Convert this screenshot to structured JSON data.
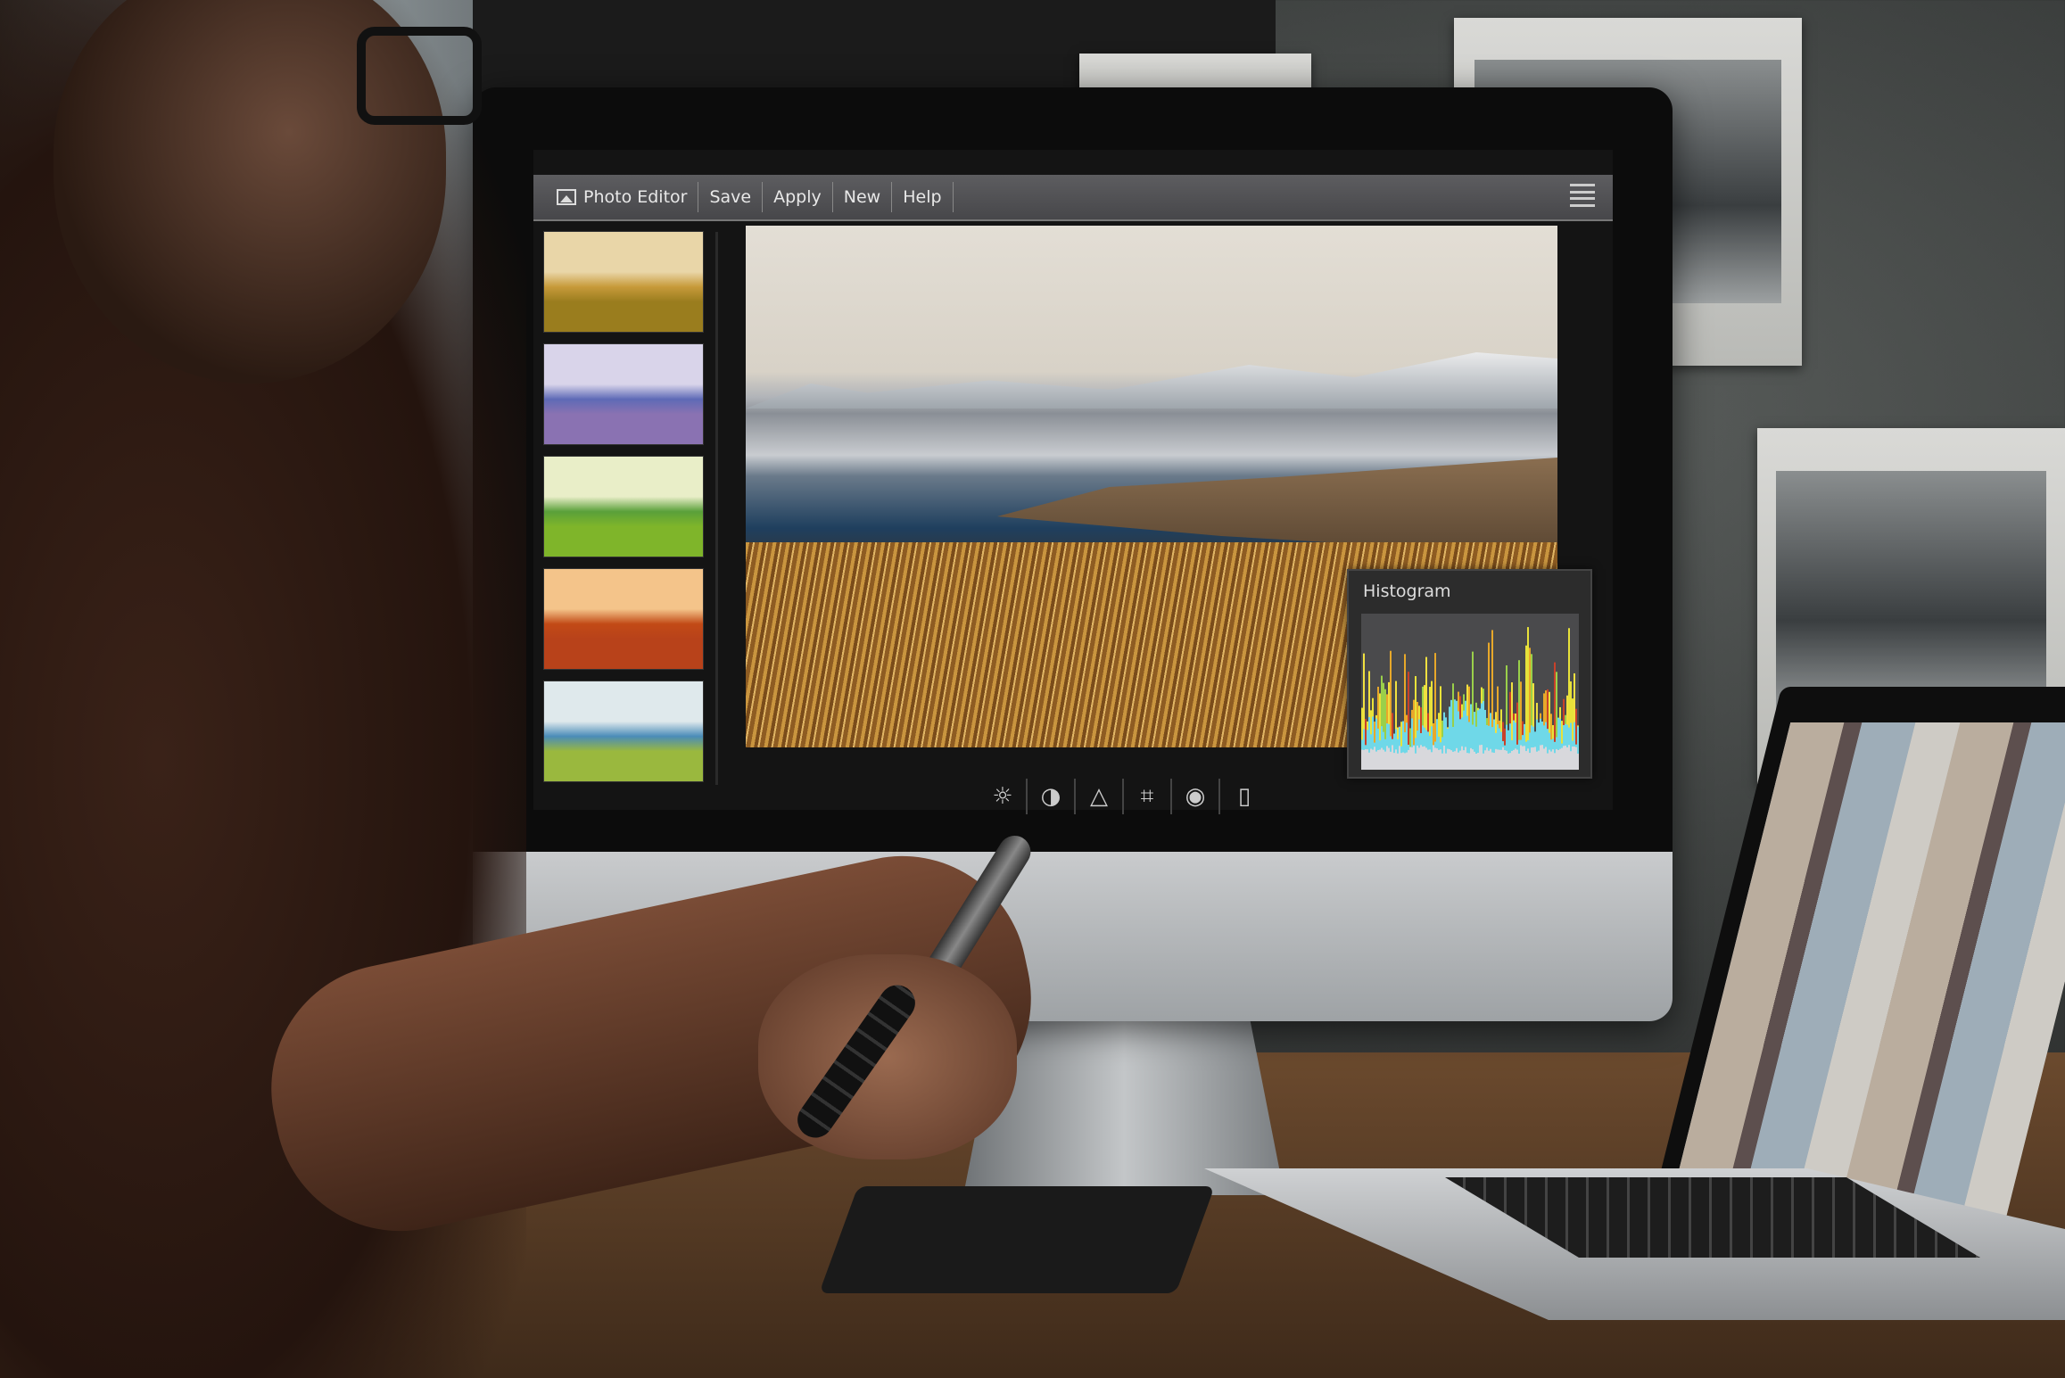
{
  "menubar": {
    "app_title": "Photo Editor",
    "items": [
      "Save",
      "Apply",
      "New",
      "Help"
    ]
  },
  "histogram": {
    "title": "Histogram"
  },
  "toolbar": {
    "tools": [
      {
        "name": "brightness",
        "icon": "☼"
      },
      {
        "name": "contrast",
        "icon": "◑"
      },
      {
        "name": "sharpen",
        "icon": "△"
      },
      {
        "name": "crop",
        "icon": "⌗"
      },
      {
        "name": "preview",
        "icon": "◉"
      },
      {
        "name": "compare",
        "icon": "▯"
      }
    ]
  },
  "thumbnails": [
    {
      "filter": "warm",
      "colors": [
        "#e9d6a8",
        "#c79a3a",
        "#9a7d1e"
      ]
    },
    {
      "filter": "purple",
      "colors": [
        "#d9d4ea",
        "#5e6ab6",
        "#8a72b2"
      ]
    },
    {
      "filter": "green",
      "colors": [
        "#e9eec8",
        "#5aa03a",
        "#7fb52a"
      ]
    },
    {
      "filter": "orange",
      "colors": [
        "#f4c48a",
        "#c24a16",
        "#b8421a"
      ]
    },
    {
      "filter": "cool",
      "colors": [
        "#dfe9ec",
        "#4a8cb8",
        "#9ab83e"
      ]
    }
  ],
  "colors": {
    "menubar": "#4f4f52",
    "screen": "#141414",
    "histogram_panel": "#2c2c2c"
  }
}
